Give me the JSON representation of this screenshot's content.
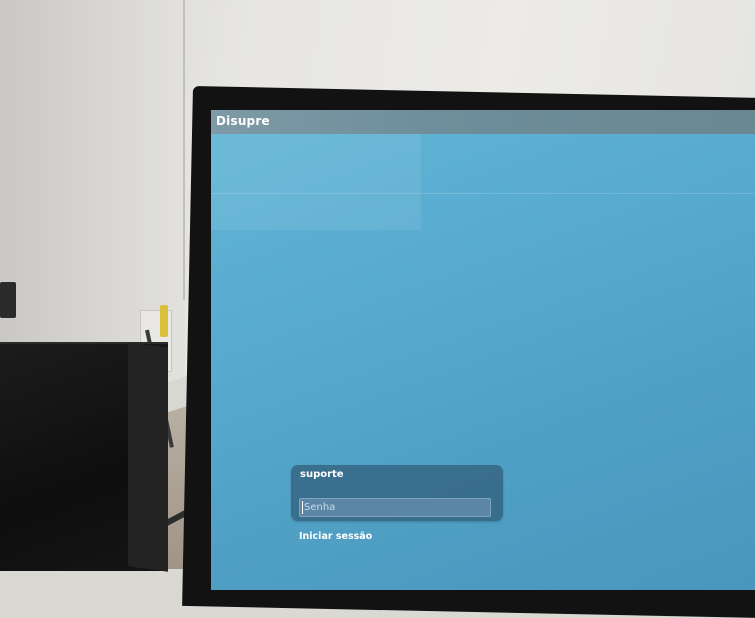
{
  "top_bar": {
    "title": "Disupre"
  },
  "login": {
    "username": "suporte",
    "password_placeholder": "Senha",
    "submit_label": "Iniciar sessão"
  },
  "colors": {
    "screen_background": "#58abcf",
    "top_bar": "#6e8e9b",
    "login_card": "#28465f",
    "text": "#ffffff"
  }
}
